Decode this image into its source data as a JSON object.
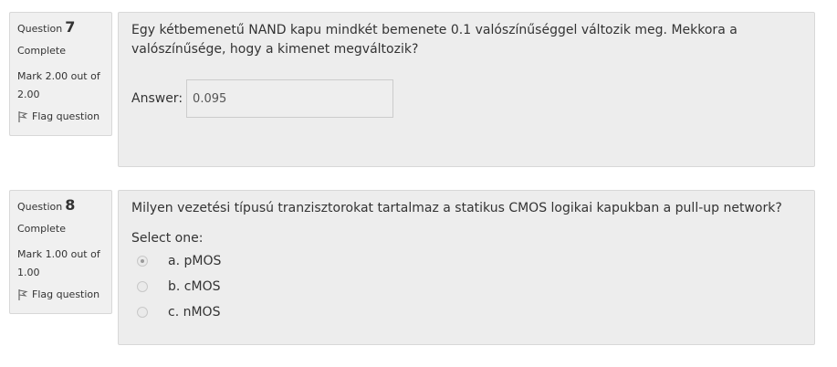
{
  "questions": [
    {
      "label": "Question",
      "number": "7",
      "state": "Complete",
      "mark_line1": "Mark 2.00 out of",
      "mark_line2": "2.00",
      "flag_label": "Flag question",
      "text": "Egy kétbemenetű NAND kapu mindkét bemenete 0.1 valószínűséggel változik meg. Mekkora a valószínűsége, hogy a kimenet megváltozik?",
      "answer_label": "Answer:",
      "answer_value": "0.095"
    },
    {
      "label": "Question",
      "number": "8",
      "state": "Complete",
      "mark_line1": "Mark 1.00 out of",
      "mark_line2": "1.00",
      "flag_label": "Flag question",
      "text": "Milyen vezetési típusú tranzisztorokat tartalmaz a statikus CMOS logikai kapukban a pull-up network?",
      "select_label": "Select one:",
      "options": [
        {
          "label": "a. pMOS",
          "selected": true
        },
        {
          "label": "b. cMOS",
          "selected": false
        },
        {
          "label": "c. nMOS",
          "selected": false
        }
      ]
    }
  ]
}
